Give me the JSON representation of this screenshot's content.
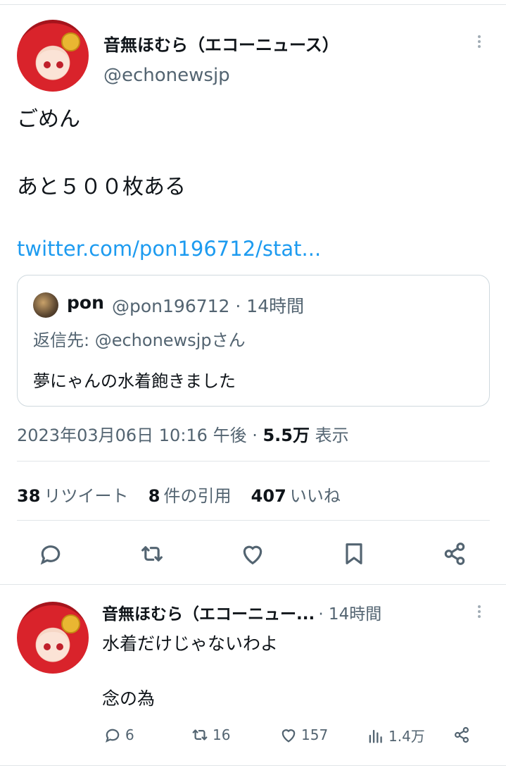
{
  "main_tweet": {
    "display_name": "音無ほむら（エコーニュース）",
    "handle": "@echonewsjp",
    "text_line1": "ごめん",
    "text_line2": "あと５００枚ある",
    "link": "twitter.com/pon196712/stat...",
    "quote": {
      "name": "pon",
      "handle_time": "@pon196712 · 14時間",
      "reply_to": "返信先: @echonewsjpさん",
      "text": "夢にゃんの水着飽きました"
    },
    "timestamp": "2023年03月06日 10:16 午後 ·",
    "views_count": "5.5万",
    "views_label": "表示",
    "stats": {
      "retweets_count": "38",
      "retweets_label": "リツイート",
      "quotes_count": "8",
      "quotes_label": "件の引用",
      "likes_count": "407",
      "likes_label": "いいね"
    }
  },
  "reply_tweet": {
    "display_name": "音無ほむら（エコーニュー...",
    "time": "· 14時間",
    "text_line1": "水着だけじゃないわよ",
    "text_line2": "念の為",
    "counts": {
      "replies": "6",
      "retweets": "16",
      "likes": "157",
      "views": "1.4万"
    }
  },
  "icons": [
    "more-icon",
    "reply-icon",
    "retweet-icon",
    "like-icon",
    "bookmark-icon",
    "share-icon",
    "views-icon"
  ],
  "colors": {
    "link": "#1d9bf0",
    "secondary": "#536471",
    "text": "#0f1419",
    "border": "#cfd9de"
  }
}
